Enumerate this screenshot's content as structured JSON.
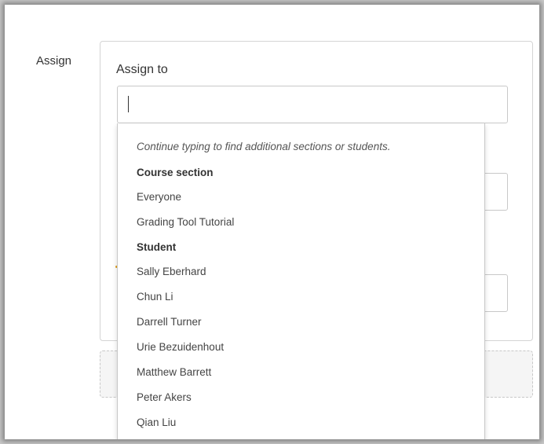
{
  "assign": {
    "label": "Assign",
    "assign_to_label": "Assign to",
    "input_value": ""
  },
  "dropdown": {
    "hint": "Continue typing to find additional sections or students.",
    "groups": [
      {
        "heading": "Course section",
        "items": [
          "Everyone",
          "Grading Tool Tutorial"
        ]
      },
      {
        "heading": "Student",
        "items": [
          "Sally Eberhard",
          "Chun Li",
          "Darrell Turner",
          "Urie Bezuidenhout",
          "Matthew Barrett",
          "Peter Akers",
          "Qian Liu"
        ]
      }
    ]
  }
}
